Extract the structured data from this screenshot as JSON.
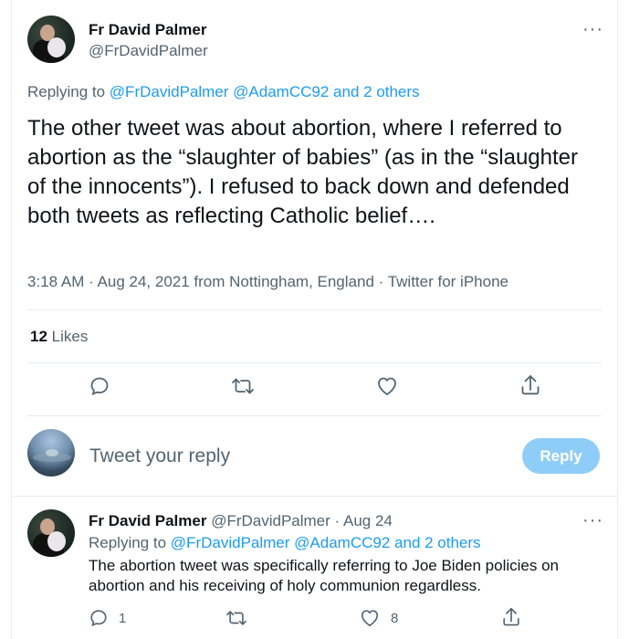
{
  "main_tweet": {
    "author_name": "Fr David Palmer",
    "author_handle": "@FrDavidPalmer",
    "replying_prefix": "Replying to",
    "replying_handle_1": "@FrDavidPalmer",
    "replying_handle_2": "@AdamCC92",
    "replying_others": "and 2 others",
    "text": "The other tweet was about abortion, where I referred to abortion as the “slaughter of babies” (as in the “slaughter of the innocents”). I refused to back down and defended both tweets as reflecting Catholic belief….",
    "meta": "3:18 AM · Aug 24, 2021 from Nottingham, England · Twitter for iPhone",
    "likes_count": "12",
    "likes_label": "Likes",
    "more_icon": "more-horizontal-icon"
  },
  "compose": {
    "placeholder": "Tweet your reply",
    "button_label": "Reply"
  },
  "reply_tweet": {
    "author_name": "Fr David Palmer",
    "author_handle": "@FrDavidPalmer",
    "date": "· Aug 24",
    "replying_prefix": "Replying to",
    "replying_handle_1": "@FrDavidPalmer",
    "replying_handle_2": "@AdamCC92",
    "replying_others": "and 2 others",
    "text": "The abortion tweet was specifically referring to Joe Biden policies on abortion and his receiving of holy communion regardless.",
    "reply_count": "1",
    "like_count": "8"
  },
  "colors": {
    "accent": "#1d9bf0",
    "muted": "#536471",
    "reply_button": "#8ecdf8",
    "border": "#e6ecf0"
  }
}
